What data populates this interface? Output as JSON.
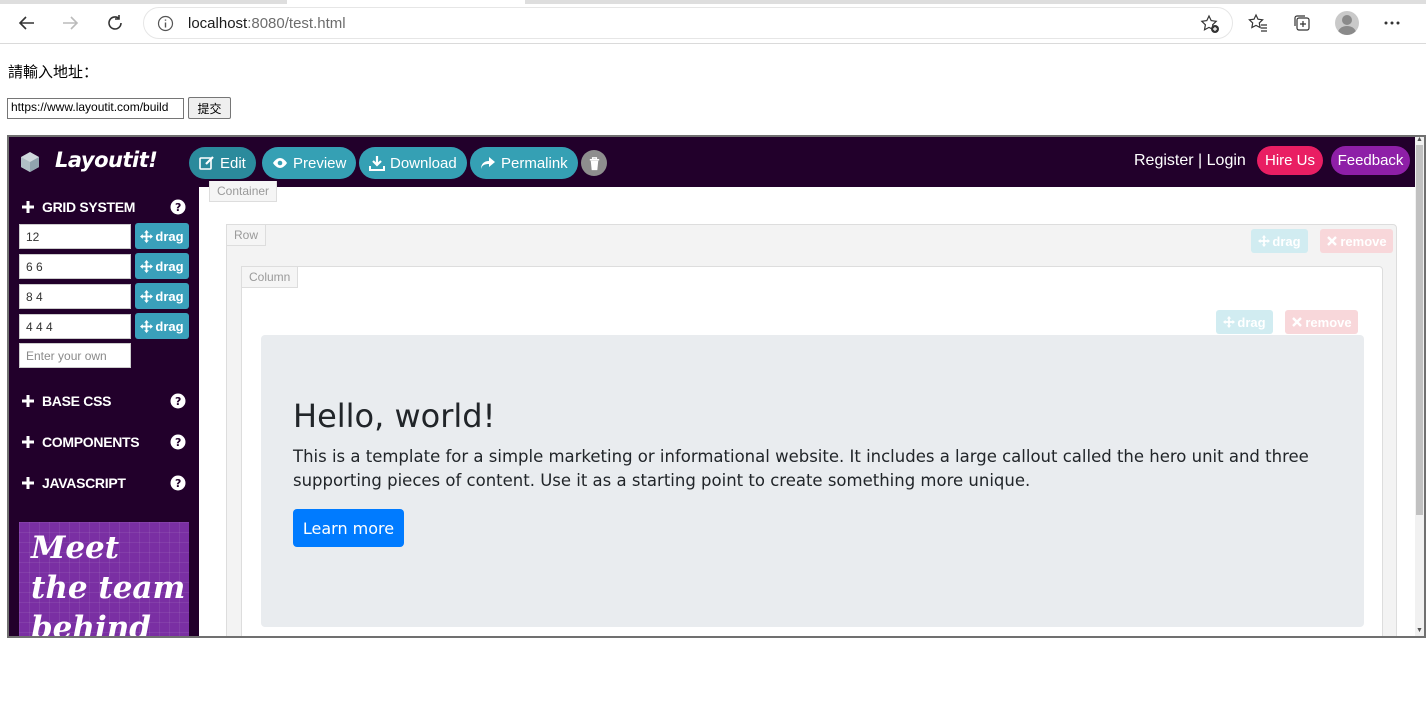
{
  "browser": {
    "url_host": "localhost",
    "url_rest": ":8080/test.html"
  },
  "form": {
    "prompt_label": "請輸入地址：",
    "url_value": "https://www.layoutit.com/build",
    "submit_label": "提交"
  },
  "layoutit": {
    "brand": "Layoutit!",
    "nav_buttons": {
      "edit": "Edit",
      "preview": "Preview",
      "download": "Download",
      "permalink": "Permalink"
    },
    "register": "Register",
    "separator": "|",
    "login": "Login",
    "hire_us": "Hire Us",
    "feedback": "Feedback"
  },
  "sidebar": {
    "grid_system": "GRID SYSTEM",
    "grid_rows": [
      "12",
      "6 6",
      "8 4",
      "4 4 4"
    ],
    "drag_label": "drag",
    "custom_placeholder": "Enter your own",
    "base_css": "BASE CSS",
    "components": "COMPONENTS",
    "javascript": "JAVASCRIPT",
    "promo_lines": [
      "Meet",
      "the team",
      "behind"
    ]
  },
  "canvas": {
    "container_label": "Container",
    "row_label": "Row",
    "column_label": "Column",
    "drag_label": "drag",
    "remove_label": "remove",
    "hero_title": "Hello, world!",
    "hero_text": "This is a template for a simple marketing or informational website. It includes a large callout called the hero unit and three supporting pieces of content. Use it as a starting point to create something more unique.",
    "hero_button": "Learn more"
  }
}
